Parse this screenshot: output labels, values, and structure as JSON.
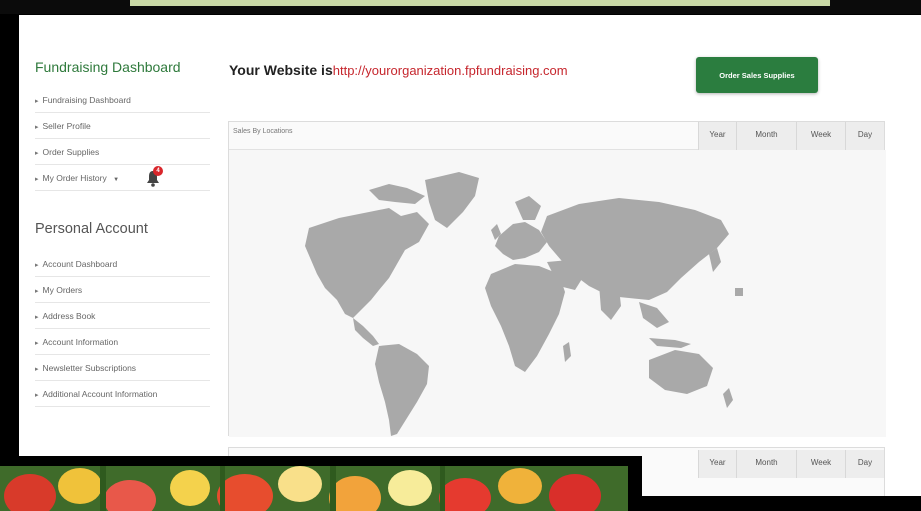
{
  "sidebar": {
    "fundraising_title": "Fundraising Dashboard",
    "fundraising_items": [
      {
        "label": "Fundraising Dashboard"
      },
      {
        "label": "Seller Profile"
      },
      {
        "label": "Order Supplies"
      },
      {
        "label": "My Order History"
      }
    ],
    "notification_count": "4",
    "personal_title": "Personal Account",
    "personal_items": [
      {
        "label": "Account Dashboard"
      },
      {
        "label": "My Orders"
      },
      {
        "label": "Address Book"
      },
      {
        "label": "Account Information"
      },
      {
        "label": "Newsletter Subscriptions"
      },
      {
        "label": "Additional Account Information"
      }
    ]
  },
  "header": {
    "website_label": "Your Website is",
    "website_url": "http://yourorganization.fpfundraising.com",
    "order_button": "Order Sales Supplies"
  },
  "sales_card": {
    "title": "Sales By Locations",
    "tabs": [
      "Year",
      "Month",
      "Week",
      "Day"
    ]
  },
  "second_card": {
    "tabs": [
      "Year",
      "Month",
      "Week",
      "Day"
    ]
  },
  "colors": {
    "brand_green": "#2b7d3f",
    "url_red": "#c6262d",
    "map_land": "#a9a9a9"
  },
  "icons": [
    "chevron-right-icon",
    "bell-icon"
  ]
}
